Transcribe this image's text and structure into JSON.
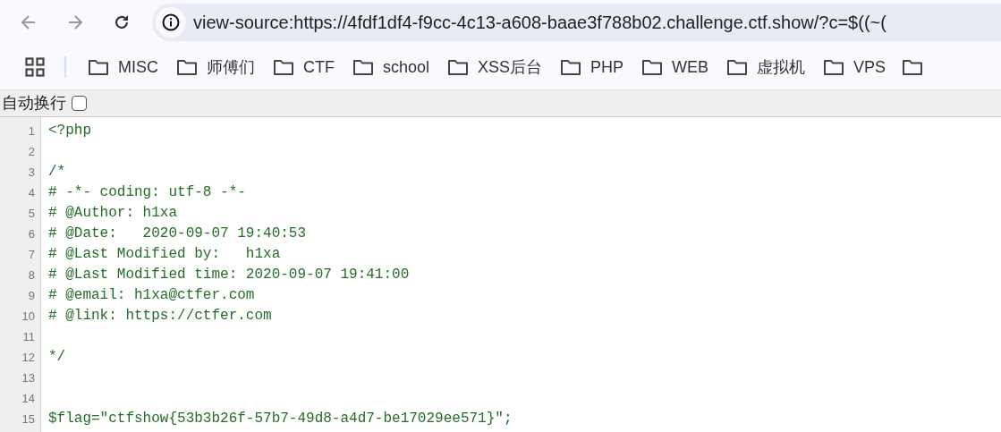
{
  "address_bar": {
    "url": "view-source:https://4fdf1df4-f9cc-4c13-a608-baae3f788b02.challenge.ctf.show/?c=$((~("
  },
  "bookmarks": [
    {
      "label": "MISC"
    },
    {
      "label": "师傅们"
    },
    {
      "label": "CTF"
    },
    {
      "label": "school"
    },
    {
      "label": "XSS后台"
    },
    {
      "label": "PHP"
    },
    {
      "label": "WEB"
    },
    {
      "label": "虚拟机"
    },
    {
      "label": "VPS"
    }
  ],
  "wrap_toggle": {
    "label": "自动换行",
    "checked": false
  },
  "source_lines": [
    {
      "number": "1",
      "text": "<?php"
    },
    {
      "number": "2"
    },
    {
      "number": "3",
      "text": "/*"
    },
    {
      "number": "4",
      "text": "# -*- coding: utf-8 -*-"
    },
    {
      "number": "5",
      "text": "# @Author: h1xa"
    },
    {
      "number": "6",
      "text": "# @Date:   2020-09-07 19:40:53"
    },
    {
      "number": "7",
      "text": "# @Last Modified by:   h1xa"
    },
    {
      "number": "8",
      "text": "# @Last Modified time: 2020-09-07 19:41:00"
    },
    {
      "number": "9",
      "text": "# @email: h1xa@ctfer.com"
    },
    {
      "number": "10",
      "text": "# @link: https://ctfer.com"
    },
    {
      "number": "11"
    },
    {
      "number": "12",
      "text": "*/"
    },
    {
      "number": "13"
    },
    {
      "number": "14"
    },
    {
      "number": "15",
      "text": "$flag=\"ctfshow{53b3b26f-57b7-49d8-a4d7-be17029ee571}\";"
    }
  ]
}
